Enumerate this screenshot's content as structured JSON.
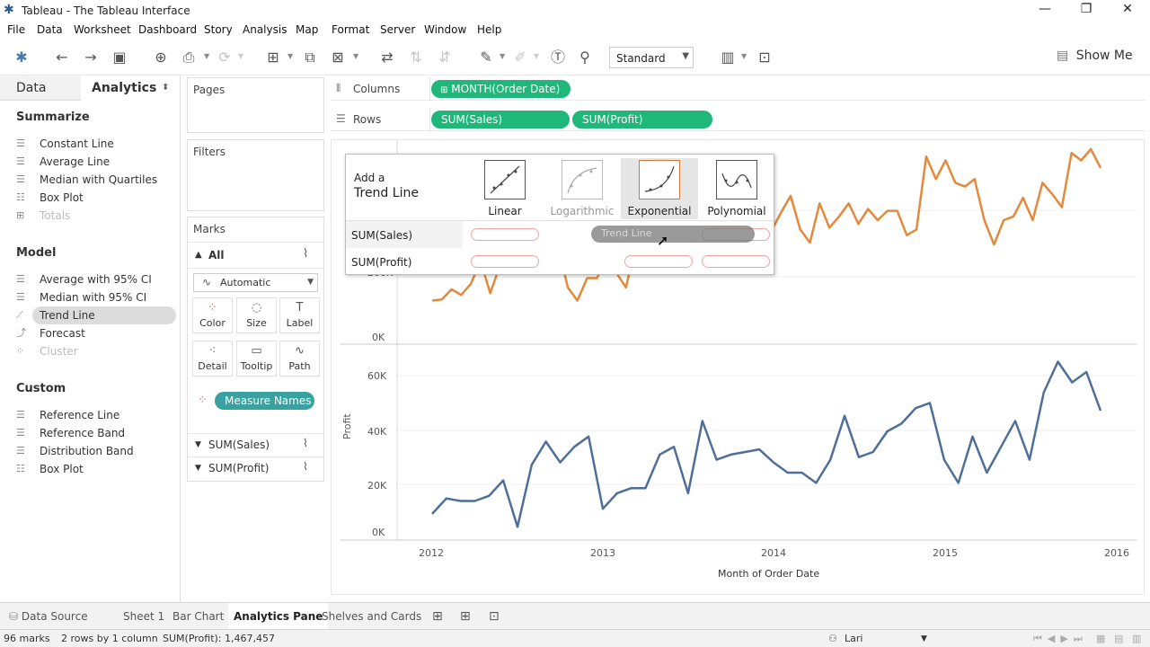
{
  "window": {
    "title": "Tableau - The Tableau Interface"
  },
  "menu": [
    "File",
    "Data",
    "Worksheet",
    "Dashboard",
    "Story",
    "Analysis",
    "Map",
    "Format",
    "Server",
    "Window",
    "Help"
  ],
  "toolbar": {
    "fit_select": "Standard",
    "show_me": "Show Me"
  },
  "left_pane": {
    "tabs": [
      "Data",
      "Analytics"
    ],
    "sections": [
      {
        "title": "Summarize",
        "items": [
          "Constant Line",
          "Average Line",
          "Median with Quartiles",
          "Box Plot",
          "Totals"
        ]
      },
      {
        "title": "Model",
        "items": [
          "Average with 95% CI",
          "Median with 95% CI",
          "Trend Line",
          "Forecast",
          "Cluster"
        ]
      },
      {
        "title": "Custom",
        "items": [
          "Reference Line",
          "Reference Band",
          "Distribution Band",
          "Box Plot"
        ]
      }
    ]
  },
  "cards": {
    "pages": "Pages",
    "filters": "Filters",
    "marks": {
      "title": "Marks",
      "all": "All",
      "mark_type": "Automatic",
      "buttons": [
        "Color",
        "Size",
        "Label",
        "Detail",
        "Tooltip",
        "Path"
      ],
      "measure_names": "Measure Names",
      "measures": [
        "SUM(Sales)",
        "SUM(Profit)"
      ]
    }
  },
  "shelves": {
    "columns_label": "Columns",
    "rows_label": "Rows",
    "columns": [
      "MONTH(Order Date)"
    ],
    "rows": [
      "SUM(Sales)",
      "SUM(Profit)"
    ]
  },
  "view": {
    "sales_ticks": [
      "200K",
      "0K"
    ],
    "profit_ticks": [
      "60K",
      "40K",
      "20K",
      "0K"
    ],
    "profit_axis_title": "Profit",
    "x_ticks": [
      "2012",
      "2013",
      "2014",
      "2015",
      "2016"
    ],
    "x_title": "Month of Order Date",
    "sales_color": "#e3893c",
    "profit_color": "#4e6f99"
  },
  "chart_data": {
    "type": "line",
    "x_ticks": [
      "2012",
      "2013",
      "2014",
      "2015",
      "2016"
    ],
    "xlabel": "Month of Order Date",
    "series": [
      {
        "axis": "Sales",
        "ylim": [
          0,
          500000
        ],
        "values": [
          95000,
          98000,
          125000,
          110000,
          140000,
          200000,
          115000,
          190000,
          240000,
          210000,
          230000,
          250000,
          200000,
          240000,
          130000,
          95000,
          155000,
          155000,
          200000,
          170000,
          130000,
          240000,
          210000,
          220000,
          200000,
          245000,
          190000,
          175000,
          210000,
          250000,
          190000,
          270000,
          370000,
          225000,
          310000,
          280000,
          330000,
          375000,
          285000,
          250000,
          355000,
          290000,
          320000,
          355000,
          300000,
          340000,
          310000,
          335000,
          335000,
          270000,
          285000,
          480000,
          420000,
          470000,
          410000,
          400000,
          420000,
          310000,
          245000,
          310000,
          320000,
          370000,
          310000,
          410000,
          380000,
          345000,
          490000,
          470000,
          500000,
          450000
        ]
      },
      {
        "name": "Profit",
        "axis": "Profit",
        "ylim": [
          0,
          70000
        ],
        "values": [
          7000,
          13000,
          12000,
          12000,
          14000,
          20000,
          2000,
          26000,
          35000,
          27000,
          33000,
          37000,
          9000,
          15000,
          17000,
          17000,
          30000,
          33000,
          15000,
          43000,
          28000,
          30000,
          31000,
          32000,
          27000,
          23000,
          23000,
          19000,
          28000,
          45000,
          29000,
          31000,
          39000,
          42000,
          48000,
          50000,
          28000,
          19000,
          37000,
          23000,
          33000,
          43000,
          28000,
          54000,
          66000,
          58000,
          62000,
          47000
        ]
      }
    ]
  },
  "trend_popup": {
    "add_a": "Add a",
    "title": "Trend Line",
    "models": [
      "Linear",
      "Logarithmic",
      "Exponential",
      "Polynomial"
    ],
    "rows": [
      "SUM(Sales)",
      "SUM(Profit)"
    ],
    "drag_label": "Trend Line"
  },
  "sheet_tabs": [
    "Data Source",
    "Sheet 1",
    "Bar Chart",
    "Analytics Pane",
    "Shelves and Cards"
  ],
  "status": {
    "marks": "96 marks",
    "dims": "2 rows by 1 column",
    "sum": "SUM(Profit): 1,467,457",
    "user": "Lari"
  }
}
